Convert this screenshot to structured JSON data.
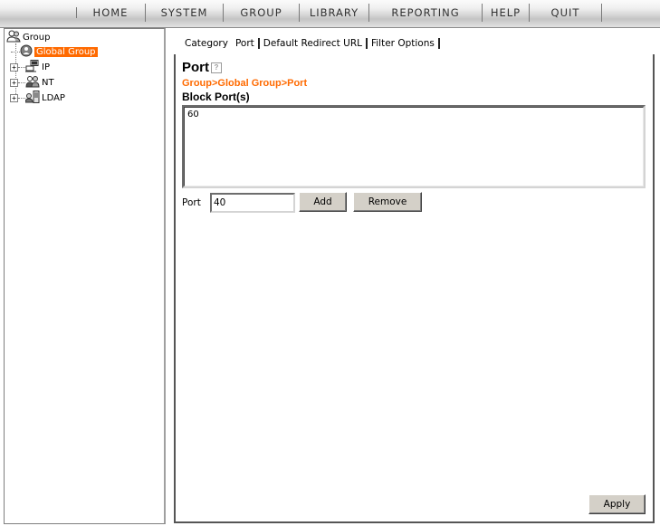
{
  "menu": [
    "HOME",
    "SYSTEM",
    "GROUP",
    "LIBRARY",
    "REPORTING",
    "HELP",
    "QUIT"
  ],
  "tree": {
    "root_label": "Group",
    "nodes": [
      {
        "label": "Global Group",
        "selected": true,
        "expander": ""
      },
      {
        "label": "IP",
        "expander": "+"
      },
      {
        "label": "NT",
        "expander": "+"
      },
      {
        "label": "LDAP",
        "expander": "+"
      }
    ]
  },
  "tabs": [
    "Category",
    "Port",
    "Default Redirect URL",
    "Filter Options"
  ],
  "page": {
    "title": "Port",
    "help_icon_glyph": "?",
    "breadcrumb": "Group>Global Group>Port",
    "section_title": "Block Port(s)"
  },
  "ports_list": [
    "60"
  ],
  "port_field": {
    "label": "Port",
    "value": "40"
  },
  "buttons": {
    "add": "Add",
    "remove": "Remove",
    "apply": "Apply"
  },
  "colors": {
    "accent": "#ff6a00",
    "selected_bg": "#ff6a00",
    "breadcrumb": "#ff6a00"
  },
  "icons": {
    "root": "group-users-icon",
    "global": "global-group-icon",
    "ip": "computer-network-icon",
    "nt": "nt-users-icon",
    "ldap": "ldap-server-icon",
    "help": "help-icon"
  }
}
